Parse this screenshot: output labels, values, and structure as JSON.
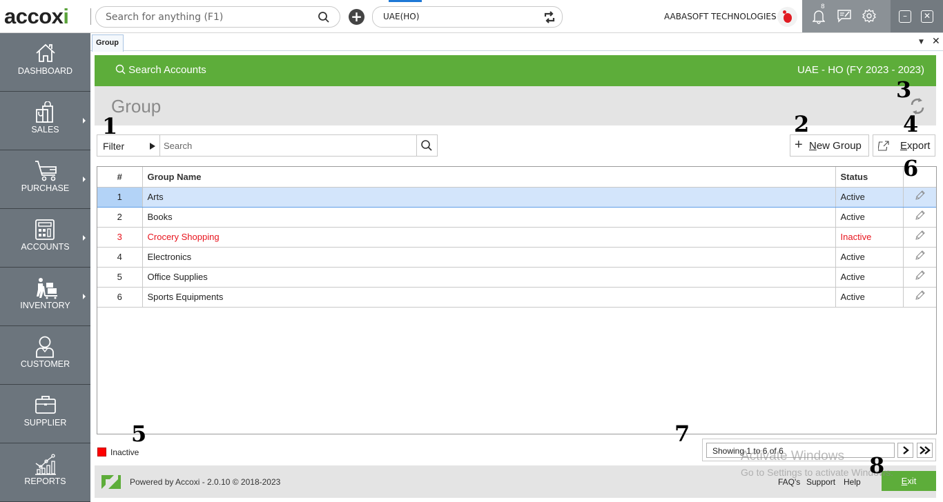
{
  "topbar": {
    "logo_text": "accox",
    "logo_leaf": "i",
    "search_placeholder": "Search for anything (F1)",
    "branch_value": "UAE(HO)",
    "company_name": "AABASOFT TECHNOLOGIES",
    "notification_count": "8",
    "icons": [
      "search-icon",
      "add-icon",
      "swap-icon",
      "bell-icon",
      "message-edit-icon",
      "gear-icon",
      "minimize-icon",
      "close-icon"
    ]
  },
  "sidebar": {
    "items": [
      {
        "label": "DASHBOARD",
        "icon": "home-icon",
        "has_submenu": false
      },
      {
        "label": "SALES",
        "icon": "shopping-bag-icon",
        "has_submenu": true
      },
      {
        "label": "PURCHASE",
        "icon": "cart-icon",
        "has_submenu": true
      },
      {
        "label": "ACCOUNTS",
        "icon": "calculator-icon",
        "has_submenu": true
      },
      {
        "label": "INVENTORY",
        "icon": "warehouse-worker-icon",
        "has_submenu": true
      },
      {
        "label": "CUSTOMER",
        "icon": "user-icon",
        "has_submenu": false
      },
      {
        "label": "SUPPLIER",
        "icon": "briefcase-icon",
        "has_submenu": false
      },
      {
        "label": "REPORTS",
        "icon": "chart-icon",
        "has_submenu": false
      }
    ]
  },
  "tabs": [
    {
      "label": "Group",
      "active": true
    }
  ],
  "header": {
    "search_accounts": "Search Accounts",
    "fiscal_label": "UAE - HO (FY 2023 - 2023)",
    "page_title": "Group"
  },
  "toolbar": {
    "filter_label": "Filter",
    "search_placeholder": "Search",
    "new_group_prefix": "",
    "new_group_underline": "N",
    "new_group_rest": "ew Group",
    "export_underline": "E",
    "export_rest": "xport"
  },
  "table": {
    "columns": [
      "#",
      "Group Name",
      "Status",
      ""
    ],
    "rows": [
      {
        "num": "1",
        "name": "Arts",
        "status": "Active",
        "selected": true,
        "inactive": false
      },
      {
        "num": "2",
        "name": "Books",
        "status": "Active",
        "selected": false,
        "inactive": false
      },
      {
        "num": "3",
        "name": "Crocery Shopping",
        "status": "Inactive",
        "selected": false,
        "inactive": true
      },
      {
        "num": "4",
        "name": "Electronics",
        "status": "Active",
        "selected": false,
        "inactive": false
      },
      {
        "num": "5",
        "name": "Office Supplies",
        "status": "Active",
        "selected": false,
        "inactive": false
      },
      {
        "num": "6",
        "name": "Sports Equipments",
        "status": "Active",
        "selected": false,
        "inactive": false
      }
    ]
  },
  "legend": {
    "label": "Inactive",
    "color": "#ff0000"
  },
  "pager": {
    "info": "Showing 1 to 6 of 6",
    "next": "›",
    "last": "»"
  },
  "footer": {
    "powered": "Powered by Accoxi - 2.0.10 © 2018-2023",
    "links": [
      "FAQ's",
      "Support",
      "Help"
    ],
    "exit_underline": "E",
    "exit_rest": "xit"
  },
  "watermark": {
    "line1": "Activate Windows",
    "line2": "Go to Settings to activate Windows."
  },
  "callouts": [
    "1",
    "2",
    "3",
    "4",
    "5",
    "6",
    "7",
    "8"
  ],
  "colors": {
    "brand_green": "#5dad3a",
    "sidebar": "#6c757d",
    "inactive_red": "#e8141d",
    "selected_row": "#d3e5fb"
  }
}
